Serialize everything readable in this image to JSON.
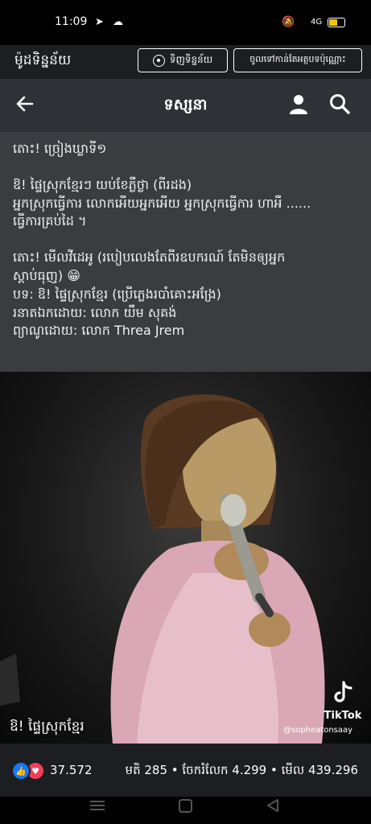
{
  "status_bar": {
    "time": "11:09",
    "network": "4G"
  },
  "app_bar": {
    "app_name": "ម៉ូដទិន្នន័យ",
    "radio_button_label": "ទិញទិន្នន័យ",
    "subscribe_button_label": "ចូលទៅកាន់តែអត្ថបទប៉ុណ្ណោះ"
  },
  "nav": {
    "title": "ទស្សនា"
  },
  "post": {
    "lines": [
      "តោះ! ច្រៀងឃ្លាទី១",
      "",
      "ឱ! ផ្ទៃស្រុកខ្មែរៗ យប់ខែភ្លឺថ្លា (ពីរដង)",
      "អ្នកស្រុកធ្វើការ លោកអើយអ្នកអើយ អ្នកស្រុកធ្វើការ ហាអឺ ......",
      "ធ្វើការគ្រប់ដៃ ។",
      "",
      "តោះ!  មើលវីដេអូ (របៀបលេងតែពីរឧបករណ៍ តែមិនឲ្យអ្នក",
      "ស្តាប់ធុញ) 😁",
      "បទ: ឱ! ផ្ទៃស្រុកខ្មែរ (ប្រើភ្លេងរបាំគោះអង្រែ)",
      "រនាតឯកដោយ: លោក យឹម សុគង់",
      "ព្យាណូដោយ: លោក Threa Jrem"
    ]
  },
  "video": {
    "caption": "ឱ! ផ្ទៃស្រុកខ្មែរ",
    "watermark": "TikTok",
    "handle": "@sopheatonsaay"
  },
  "stats": {
    "reaction_count": "37.572",
    "comments": "មតិ 285",
    "shares": "ចែករំលែក 4.299",
    "views": "មើល 439.296",
    "separator": " • "
  },
  "colors": {
    "like_blue": "#1877f2",
    "love_red": "#f33e58",
    "battery_yellow": "#f5c400"
  }
}
